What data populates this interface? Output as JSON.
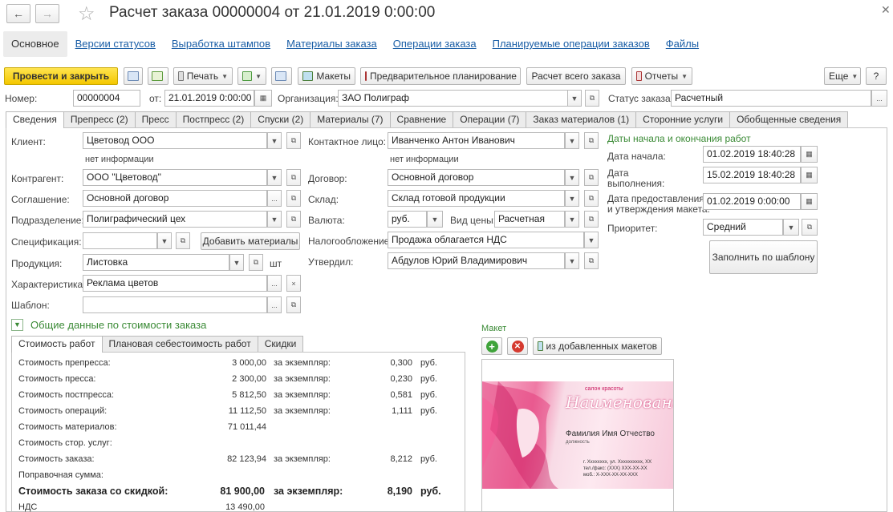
{
  "window": {
    "title": "Расчет заказа 00000004 от 21.01.2019 0:00:00"
  },
  "nav_tabs": [
    "Основное",
    "Версии статусов",
    "Выработка штампов",
    "Материалы заказа",
    "Операции заказа",
    "Планируемые операции заказов",
    "Файлы"
  ],
  "toolbar": {
    "post_close": "Провести и закрыть",
    "print": "Печать",
    "layouts": "Макеты",
    "prelim": "Предварительное планирование",
    "calc_all": "Расчет всего заказа",
    "reports": "Отчеты",
    "more": "Еще",
    "help": "?"
  },
  "header": {
    "number_label": "Номер:",
    "number": "00000004",
    "from_label": "от:",
    "date": "21.01.2019  0:00:00",
    "org_label": "Организация:",
    "org": "ЗАО Полиграф",
    "status_label": "Статус заказа:",
    "status": "Расчетный"
  },
  "tabs": [
    "Сведения",
    "Препресс (2)",
    "Пресс",
    "Постпресс (2)",
    "Спуски (2)",
    "Материалы (7)",
    "Сравнение",
    "Операции (7)",
    "Заказ материалов (1)",
    "Сторонние услуги",
    "Обобщенные сведения"
  ],
  "left": {
    "client_label": "Клиент:",
    "client": "Цветовод ООО",
    "client_info": "нет информации",
    "contr_label": "Контрагент:",
    "contr": "ООО \"Цветовод\"",
    "agree_label": "Соглашение:",
    "agree": "Основной договор",
    "dept_label": "Подразделение:",
    "dept": "Полиграфический цех",
    "spec_label": "Спецификация:",
    "spec": "",
    "add_materials": "Добавить материалы",
    "prod_label": "Продукция:",
    "prod": "Листовка",
    "unit": "шт",
    "char_label": "Характеристика:",
    "char": "Реклама цветов",
    "tmpl_label": "Шаблон:",
    "tmpl": ""
  },
  "mid": {
    "contact_label": "Контактное лицо:",
    "contact": "Иванченко Антон Иванович",
    "contact_info": "нет информации",
    "contract_label": "Договор:",
    "contract": "Основной договор",
    "wh_label": "Склад:",
    "wh": "Склад готовой продукции",
    "cur_label": "Валюта:",
    "cur": "руб.",
    "price_label": "Вид цены:",
    "price": "Расчетная",
    "tax_label": "Налогообложение:",
    "tax": "Продажа облагается НДС",
    "appr_label": "Утвердил:",
    "appr": "Абдулов Юрий Владимирович"
  },
  "right": {
    "section": "Даты начала и окончания работ",
    "start_label": "Дата начала:",
    "start": "01.02.2019 18:40:28",
    "done_label1": "Дата",
    "done_label2": "выполнения:",
    "done": "15.02.2019 18:40:28",
    "pres_label1": "Дата предоставления",
    "pres_label2": "и утверждения макета:",
    "pres": "01.02.2019  0:00:00",
    "prio_label": "Приоритет:",
    "prio": "Средний",
    "fill": "Заполнить по шаблону"
  },
  "cost": {
    "section": "Общие данные по стоимости заказа",
    "tabs": [
      "Стоимость работ",
      "Плановая себестоимость работ",
      "Скидки"
    ],
    "per_copy": "за экземпляр:",
    "rub": "руб.",
    "rows": [
      {
        "label": "Стоимость препресса:",
        "value": "3 000,00",
        "per": "0,300"
      },
      {
        "label": "Стоимость пресса:",
        "value": "2 300,00",
        "per": "0,230"
      },
      {
        "label": "Стоимость постпресса:",
        "value": "5 812,50",
        "per": "0,581"
      },
      {
        "label": "Стоимость операций:",
        "value": "11 112,50",
        "per": "1,111"
      },
      {
        "label": "Стоимость материалов:",
        "value": "71 011,44",
        "per": ""
      },
      {
        "label": "Стоимость стор. услуг:",
        "value": "",
        "per": ""
      },
      {
        "label": "Стоимость заказа:",
        "value": "82 123,94",
        "per": "8,212"
      },
      {
        "label": "Поправочная сумма:",
        "value": "",
        "per": ""
      }
    ],
    "disc_label": "Стоимость заказа со скидкой:",
    "disc_value": "81 900,00",
    "disc_per_label": "за экземпляр:",
    "disc_per": "8,190",
    "disc_rub": "руб.",
    "vat_label": "НДС",
    "vat_value": "13 490,00"
  },
  "maket": {
    "label": "Макет",
    "from_added": "из добавленных макетов",
    "card_small": "салон красоты",
    "card_title": "Наименование",
    "card_name": "Фамилия Имя Отчество",
    "card_pos": "должность",
    "card_addr": "г. Хххххххх, ул. Хххххххххх, ХХ",
    "card_phone": "тел./факс: (XXX) XXX-XX-XX",
    "card_mob": "моб.: Х-ХХХ-ХХ-ХХ-ХХХ"
  }
}
